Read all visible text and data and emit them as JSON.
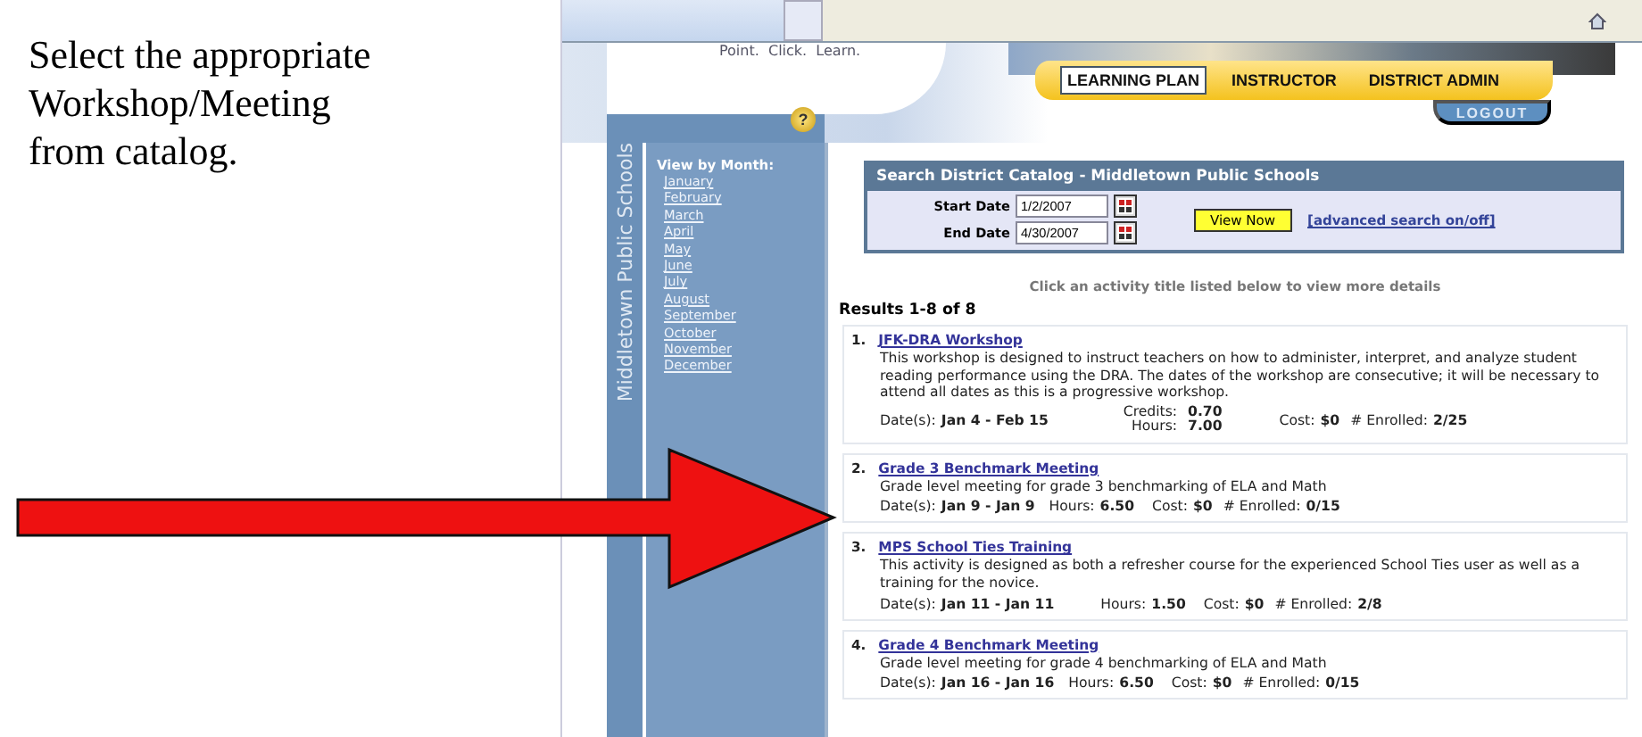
{
  "slide": {
    "caption": "Select the appropriate Workshop/Meeting from catalog."
  },
  "header": {
    "tagline": "Point.  Click.  Learn.",
    "tabs": [
      {
        "label": "LEARNING PLAN",
        "selected": true
      },
      {
        "label": "INSTRUCTOR",
        "selected": false
      },
      {
        "label": "DISTRICT ADMIN",
        "selected": false
      }
    ],
    "logout": "LOGOUT",
    "help": "?"
  },
  "sidebar": {
    "district": "Middletown Public Schools",
    "heading": "View by Month:",
    "months": [
      "January",
      "February",
      "March",
      "April",
      "May",
      "June",
      "July",
      "August",
      "September",
      "October",
      "November",
      "December"
    ]
  },
  "search": {
    "title": "Search District Catalog - Middletown Public Schools",
    "start_label": "Start Date",
    "start_value": "1/2/2007",
    "end_label": "End Date",
    "end_value": "4/30/2007",
    "button": "View Now",
    "link": "[advanced search on/off]"
  },
  "hint": "Click an activity title listed below to view more details",
  "results_count": "Results 1-8 of 8",
  "results": [
    {
      "number": "1.",
      "title": "JFK-DRA Workshop",
      "description": "This workshop is designed to instruct teachers on how to administer, interpret, and analyze student reading performance using the DRA. The dates of the workshop are consecutive; it will be necessary to attend all dates as this is a progressive workshop.",
      "dates_label": "Date(s):",
      "dates": "Jan 4 - Feb 15",
      "credits_label": "Credits:",
      "credits": "0.70",
      "hours_label": "Hours:",
      "hours": "7.00",
      "cost_label": "Cost:",
      "cost": "$0",
      "enrolled_label": "# Enrolled:",
      "enrolled": "2/25"
    },
    {
      "number": "2.",
      "title": "Grade 3 Benchmark Meeting",
      "description": "Grade level meeting for grade 3 benchmarking of ELA and Math",
      "dates_label": "Date(s):",
      "dates": "Jan 9 - Jan 9",
      "hours_label": "Hours:",
      "hours": "6.50",
      "cost_label": "Cost:",
      "cost": "$0",
      "enrolled_label": "# Enrolled:",
      "enrolled": "0/15"
    },
    {
      "number": "3.",
      "title": "MPS School Ties Training",
      "description": "This activity is designed as both a refresher course for the experienced School Ties user as well as a training for the novice.",
      "dates_label": "Date(s):",
      "dates": "Jan 11 - Jan 11",
      "hours_label": "Hours:",
      "hours": "1.50",
      "cost_label": "Cost:",
      "cost": "$0",
      "enrolled_label": "# Enrolled:",
      "enrolled": "2/8"
    },
    {
      "number": "4.",
      "title": "Grade 4 Benchmark Meeting",
      "description": "Grade level meeting for grade 4 benchmarking of ELA and Math",
      "dates_label": "Date(s):",
      "dates": "Jan 16 - Jan 16",
      "hours_label": "Hours:",
      "hours": "6.50",
      "cost_label": "Cost:",
      "cost": "$0",
      "enrolled_label": "# Enrolled:",
      "enrolled": "0/15"
    }
  ]
}
